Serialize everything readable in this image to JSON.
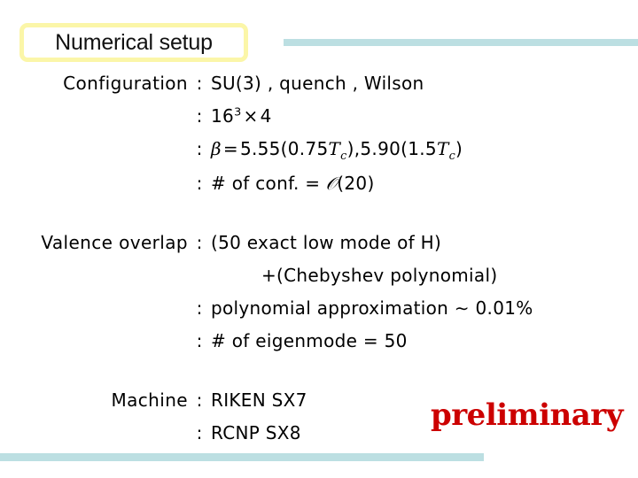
{
  "slide": {
    "title": "Numerical setup",
    "accent_color": "#bcdfe2",
    "title_border_color": "#fbf6a8",
    "stamp_color": "#cc0000"
  },
  "colon": ":",
  "sections": [
    {
      "label": "Configuration",
      "lines": [
        {
          "colon": ":",
          "parts": {
            "text": "SU(3) , quench , Wilson"
          }
        },
        {
          "colon": ":",
          "parts": {
            "base": "16",
            "exponent": "3",
            "times": "×",
            "factor": "4"
          }
        },
        {
          "colon": ":",
          "parts": {
            "beta": "β",
            "equals": "=",
            "value1": "5.55(0.75",
            "tc1": "T",
            "tc1sub": "c",
            "value1end": "),",
            "value2": "5.90(1.5",
            "tc2": "T",
            "tc2sub": "c",
            "value2end": ")"
          }
        },
        {
          "colon": ":",
          "parts": {
            "hash": "#",
            "oftext": " of conf. ",
            "equals": "=",
            "cal": " 𝒪",
            "arg": "(20)"
          }
        }
      ]
    },
    {
      "label": "Valence overlap",
      "lines": [
        {
          "colon": ":",
          "parts": {
            "text": "(50 exact low mode of H)"
          }
        },
        {
          "colon": "",
          "indent": true,
          "parts": {
            "text": "+(Chebyshev polynomial)"
          }
        },
        {
          "colon": ":",
          "parts": {
            "text": "polynomial approximation ∼ 0.01%"
          }
        },
        {
          "colon": ":",
          "parts": {
            "hash": "#",
            "oftext": " of eigenmode ",
            "equals": "=",
            "arg": " 50"
          }
        }
      ]
    },
    {
      "label": "Machine",
      "lines": [
        {
          "colon": ":",
          "parts": {
            "text": "RIKEN SX7"
          }
        },
        {
          "colon": ":",
          "parts": {
            "text": "RCNP SX8"
          }
        }
      ]
    }
  ],
  "stamp": {
    "text": "preliminary"
  }
}
